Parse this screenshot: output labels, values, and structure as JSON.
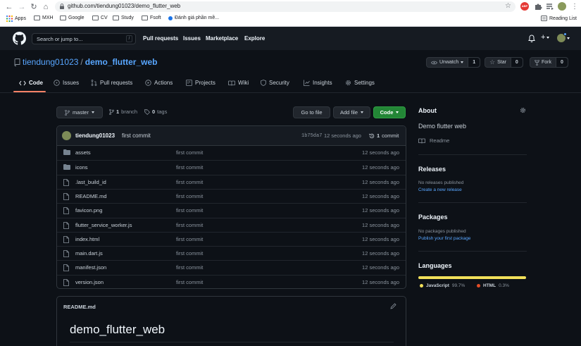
{
  "browser": {
    "url": "github.com/tiendung01023/demo_flutter_web",
    "bookmarks": [
      {
        "label": "Apps",
        "icon": "apps-grid-icon"
      },
      {
        "label": "MXH",
        "icon": "folder-icon"
      },
      {
        "label": "Google",
        "icon": "folder-icon"
      },
      {
        "label": "CV",
        "icon": "folder-icon"
      },
      {
        "label": "Study",
        "icon": "folder-icon"
      },
      {
        "label": "Fsoft",
        "icon": "folder-icon"
      },
      {
        "label": "Đánh giá phần mề...",
        "icon": "page-icon"
      }
    ],
    "reading_list": "Reading List",
    "ext_badge": "ABP"
  },
  "header": {
    "search_placeholder": "Search or jump to...",
    "slash": "/",
    "nav": [
      "Pull requests",
      "Issues",
      "Marketplace",
      "Explore"
    ]
  },
  "repo": {
    "owner": "tiendung01023",
    "separator": "/",
    "name": "demo_flutter_web",
    "watch_label": "Unwatch",
    "watch_count": "1",
    "star_label": "Star",
    "star_count": "0",
    "fork_label": "Fork",
    "fork_count": "0"
  },
  "tabs": [
    {
      "label": "Code",
      "icon": "code-icon",
      "active": true
    },
    {
      "label": "Issues",
      "icon": "issue-icon"
    },
    {
      "label": "Pull requests",
      "icon": "pull-request-icon"
    },
    {
      "label": "Actions",
      "icon": "play-icon"
    },
    {
      "label": "Projects",
      "icon": "project-icon"
    },
    {
      "label": "Wiki",
      "icon": "book-icon"
    },
    {
      "label": "Security",
      "icon": "shield-icon"
    },
    {
      "label": "Insights",
      "icon": "graph-icon"
    },
    {
      "label": "Settings",
      "icon": "gear-icon"
    }
  ],
  "branchbar": {
    "branch": "master",
    "branch_count": "1",
    "branch_word": "branch",
    "tag_count": "0",
    "tag_word": "tags",
    "goto_file": "Go to file",
    "add_file": "Add file",
    "code": "Code"
  },
  "commit": {
    "author": "tiendung01023",
    "message": "first commit",
    "sha": "1b75da7",
    "ago": "12 seconds ago",
    "count": "1",
    "count_word": "commit"
  },
  "files": [
    {
      "name": "assets",
      "type": "dir",
      "message": "first commit",
      "age": "12 seconds ago"
    },
    {
      "name": "icons",
      "type": "dir",
      "message": "first commit",
      "age": "12 seconds ago"
    },
    {
      "name": ".last_build_id",
      "type": "file",
      "message": "first commit",
      "age": "12 seconds ago"
    },
    {
      "name": "README.md",
      "type": "file",
      "message": "first commit",
      "age": "12 seconds ago"
    },
    {
      "name": "favicon.png",
      "type": "file",
      "message": "first commit",
      "age": "12 seconds ago"
    },
    {
      "name": "flutter_service_worker.js",
      "type": "file",
      "message": "first commit",
      "age": "12 seconds ago"
    },
    {
      "name": "index.html",
      "type": "file",
      "message": "first commit",
      "age": "12 seconds ago"
    },
    {
      "name": "main.dart.js",
      "type": "file",
      "message": "first commit",
      "age": "12 seconds ago"
    },
    {
      "name": "manifest.json",
      "type": "file",
      "message": "first commit",
      "age": "12 seconds ago"
    },
    {
      "name": "version.json",
      "type": "file",
      "message": "first commit",
      "age": "12 seconds ago"
    }
  ],
  "readme": {
    "filename": "README.md",
    "title": "demo_flutter_web"
  },
  "sidebar": {
    "about_title": "About",
    "description": "Demo flutter web",
    "readme_link": "Readme",
    "releases_title": "Releases",
    "releases_text": "No releases published",
    "releases_link": "Create a new release",
    "packages_title": "Packages",
    "packages_text": "No packages published",
    "packages_link": "Publish your first package",
    "languages_title": "Languages",
    "languages": [
      {
        "name": "JavaScript",
        "percent": "99.7%",
        "color": "#f1e05a",
        "value": 99.7
      },
      {
        "name": "HTML",
        "percent": "0.3%",
        "color": "#e34c26",
        "value": 0.3
      }
    ]
  }
}
